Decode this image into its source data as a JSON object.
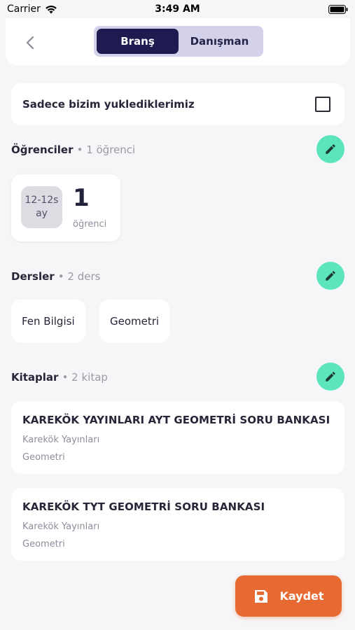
{
  "status": {
    "carrier": "Carrier",
    "time": "3:49 AM"
  },
  "header": {
    "back_icon": "chevron-left-icon",
    "tabs": [
      {
        "label": "Branş",
        "active": true
      },
      {
        "label": "Danışman",
        "active": false
      }
    ]
  },
  "filter": {
    "label": "Sadece bizim yuklediklerimiz",
    "checked": false
  },
  "students": {
    "title": "Öğrenciler",
    "count": "• 1 öğrenci",
    "items": [
      {
        "age_line1": "12-12s",
        "age_line2": "ay",
        "number": "1",
        "unit": "öğrenci"
      }
    ]
  },
  "lessons": {
    "title": "Dersler",
    "count": "• 2 ders",
    "items": [
      "Fen Bilgisi",
      "Geometri"
    ]
  },
  "books": {
    "title": "Kitaplar",
    "count": "• 2 kitap",
    "items": [
      {
        "title": "KAREKÖK YAYINLARI AYT GEOMETRİ SORU BANKASI",
        "publisher": "Karekök Yayınları",
        "subject": "Geometri"
      },
      {
        "title": "KAREKÖK TYT GEOMETRİ SORU BANKASI",
        "publisher": "Karekök Yayınları",
        "subject": "Geometri"
      }
    ]
  },
  "save": {
    "label": "Kaydet",
    "icon": "save-icon"
  },
  "colors": {
    "accent": "#e86a33",
    "edit": "#5ce5bb",
    "tab_active": "#1d1b4f",
    "tab_bg": "#d3d2ea"
  }
}
